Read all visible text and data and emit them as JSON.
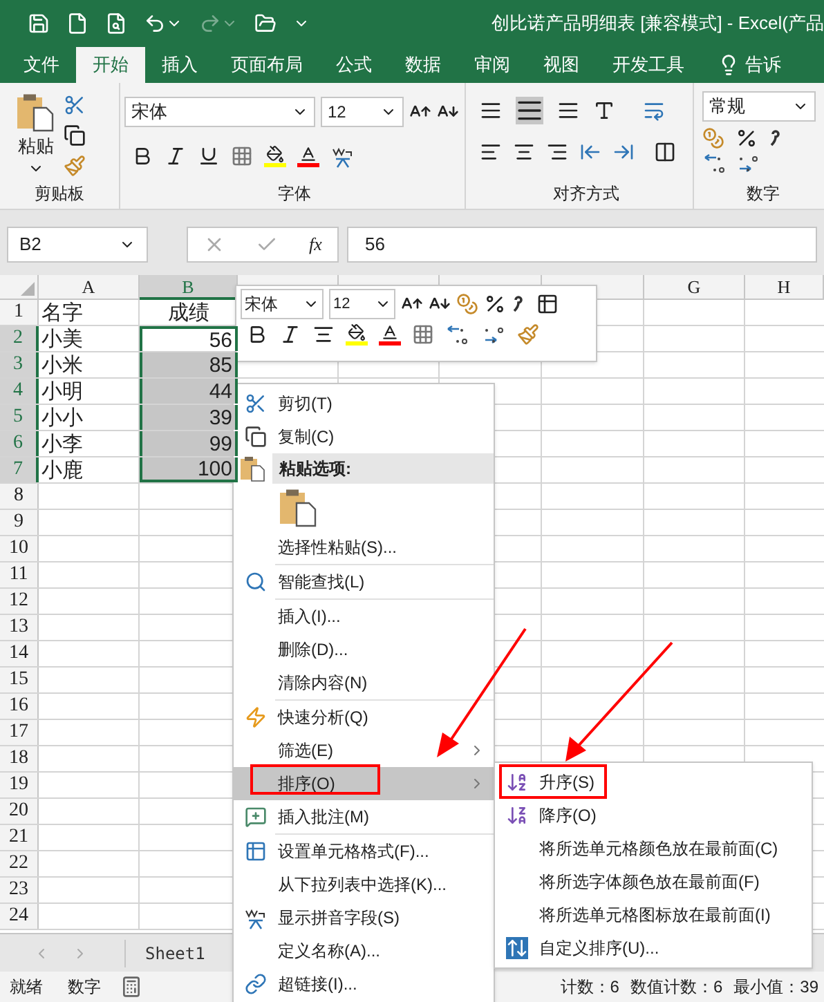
{
  "window": {
    "title": "创比诺产品明细表  [兼容模式] - Excel(产品"
  },
  "ribbon_tabs": [
    {
      "label": "文件",
      "selected": false
    },
    {
      "label": "开始",
      "selected": true
    },
    {
      "label": "插入",
      "selected": false
    },
    {
      "label": "页面布局",
      "selected": false
    },
    {
      "label": "公式",
      "selected": false
    },
    {
      "label": "数据",
      "selected": false
    },
    {
      "label": "审阅",
      "selected": false
    },
    {
      "label": "视图",
      "selected": false
    },
    {
      "label": "开发工具",
      "selected": false
    },
    {
      "label": "告诉",
      "selected": false
    }
  ],
  "ribbon": {
    "paste_label": "粘贴",
    "font_name": "宋体",
    "font_size": "12",
    "number_format": "常规",
    "groups": [
      "剪贴板",
      "字体",
      "对齐方式",
      "数字"
    ]
  },
  "formula_bar": {
    "name_box": "B2",
    "function_label": "fx",
    "value": "56"
  },
  "sheet": {
    "columns": [
      {
        "label": "A",
        "selected": false
      },
      {
        "label": "B",
        "selected": true
      },
      {
        "selected": false
      },
      {
        "selected": false
      },
      {
        "selected": false
      },
      {
        "selected": false
      },
      {
        "label": "G",
        "selected": false
      },
      {
        "label": "H",
        "selected": false
      }
    ],
    "rows": [
      {
        "number": "1",
        "selected": false,
        "cells": [
          {
            "text": "名字",
            "selected": false
          },
          {
            "text": "成绩",
            "selected": false
          }
        ]
      },
      {
        "number": "2",
        "selected": true,
        "cells": [
          {
            "text": "小美",
            "selected": false
          },
          {
            "text": "56",
            "selected": true,
            "active": true
          }
        ]
      },
      {
        "number": "3",
        "selected": true,
        "cells": [
          {
            "text": "小米",
            "selected": false
          },
          {
            "text": "85",
            "selected": true
          }
        ]
      },
      {
        "number": "4",
        "selected": true,
        "cells": [
          {
            "text": "小明",
            "selected": false
          },
          {
            "text": "44",
            "selected": true
          }
        ]
      },
      {
        "number": "5",
        "selected": true,
        "cells": [
          {
            "text": "小小",
            "selected": false
          },
          {
            "text": "39",
            "selected": true
          }
        ]
      },
      {
        "number": "6",
        "selected": true,
        "cells": [
          {
            "text": "小李",
            "selected": false
          },
          {
            "text": "99",
            "selected": true
          }
        ]
      },
      {
        "number": "7",
        "selected": true,
        "cells": [
          {
            "text": "小鹿",
            "selected": false
          },
          {
            "text": "100",
            "selected": true
          }
        ]
      },
      {
        "number": "8",
        "selected": false
      },
      {
        "number": "9",
        "selected": false
      },
      {
        "number": "10",
        "selected": false
      },
      {
        "number": "11",
        "selected": false
      },
      {
        "number": "12",
        "selected": false
      },
      {
        "number": "13",
        "selected": false
      },
      {
        "number": "14",
        "selected": false
      },
      {
        "number": "15",
        "selected": false
      },
      {
        "number": "16",
        "selected": false
      },
      {
        "number": "17",
        "selected": false
      },
      {
        "number": "18",
        "selected": false
      },
      {
        "number": "19",
        "selected": false
      },
      {
        "number": "20",
        "selected": false
      },
      {
        "number": "21",
        "selected": false
      },
      {
        "number": "22",
        "selected": false
      },
      {
        "number": "23",
        "selected": false
      },
      {
        "number": "24",
        "selected": false
      }
    ]
  },
  "mini_toolbar": {
    "font_name": "宋体",
    "font_size": "12"
  },
  "context_menu": {
    "items": [
      {
        "kind": "item",
        "label": "剪切(T)",
        "selected": false,
        "has_submenu": false
      },
      {
        "kind": "item",
        "label": "复制(C)",
        "selected": false,
        "has_submenu": false
      },
      {
        "kind": "header",
        "label": "粘贴选项:"
      },
      {
        "kind": "paste_options"
      },
      {
        "kind": "item",
        "label": "选择性粘贴(S)...",
        "selected": false,
        "has_submenu": false
      },
      {
        "kind": "separator"
      },
      {
        "kind": "item",
        "label": "智能查找(L)",
        "selected": false,
        "has_submenu": false
      },
      {
        "kind": "separator"
      },
      {
        "kind": "item",
        "label": "插入(I)...",
        "selected": false,
        "has_submenu": false
      },
      {
        "kind": "item",
        "label": "删除(D)...",
        "selected": false,
        "has_submenu": false
      },
      {
        "kind": "item",
        "label": "清除内容(N)",
        "selected": false,
        "has_submenu": false
      },
      {
        "kind": "separator"
      },
      {
        "kind": "item",
        "label": "快速分析(Q)",
        "selected": false,
        "has_submenu": false
      },
      {
        "kind": "item",
        "label": "筛选(E)",
        "selected": false,
        "has_submenu": true
      },
      {
        "kind": "item",
        "label": "排序(O)",
        "selected": true,
        "has_submenu": true
      },
      {
        "kind": "item",
        "label": "插入批注(M)",
        "selected": false,
        "has_submenu": false
      },
      {
        "kind": "separator"
      },
      {
        "kind": "item",
        "label": "设置单元格格式(F)...",
        "selected": false,
        "has_submenu": false
      },
      {
        "kind": "item",
        "label": "从下拉列表中选择(K)...",
        "selected": false,
        "has_submenu": false
      },
      {
        "kind": "item",
        "label": "显示拼音字段(S)",
        "selected": false,
        "has_submenu": false
      },
      {
        "kind": "item",
        "label": "定义名称(A)...",
        "selected": false,
        "has_submenu": false
      },
      {
        "kind": "item",
        "label": "超链接(I)...",
        "selected": false,
        "has_submenu": false
      }
    ]
  },
  "submenu": {
    "items": [
      {
        "label": "升序(S)"
      },
      {
        "label": "降序(O)"
      },
      {
        "label": "将所选单元格颜色放在最前面(C)"
      },
      {
        "label": "将所选字体颜色放在最前面(F)"
      },
      {
        "label": "将所选单元格图标放在最前面(I)"
      },
      {
        "label": "自定义排序(U)..."
      }
    ]
  },
  "sheet_tabs": [
    {
      "label": "Sheet1",
      "selected": true
    }
  ],
  "status_bar": {
    "left": [
      "就绪",
      "数字"
    ],
    "summary": [
      "计数：6",
      "数值计数：6",
      "最小值：39"
    ]
  }
}
